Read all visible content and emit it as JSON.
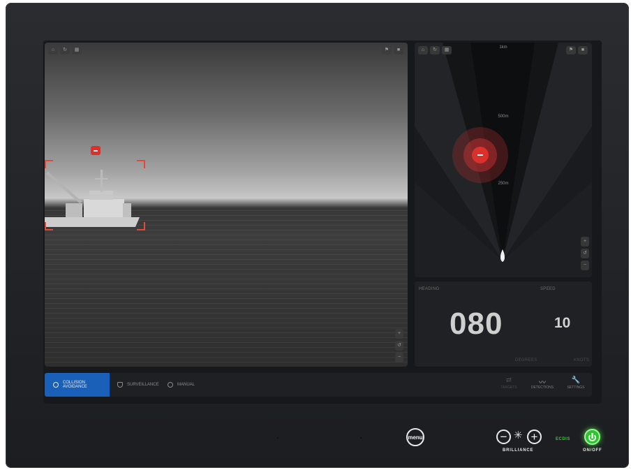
{
  "camera": {
    "toolbar_icons": [
      "home-icon",
      "rotate-icon",
      "grid-icon"
    ],
    "right_icons": [
      "flag-icon",
      "record-icon"
    ],
    "zoom_controls": [
      "+",
      "↺",
      "−"
    ]
  },
  "radar": {
    "toolbar_icons": [
      "home-icon",
      "rotate-icon",
      "grid-icon"
    ],
    "right_icons": [
      "flag-icon",
      "record-icon"
    ],
    "range_labels": [
      "1km",
      "500m",
      "250m"
    ],
    "zoom_controls": [
      "+",
      "↺",
      "−"
    ]
  },
  "nav": {
    "heading_label": "HEADING",
    "heading_value": "080",
    "heading_unit": "DEGREES",
    "speed_label": "SPEED",
    "speed_value": "10",
    "speed_unit": "KNOTS"
  },
  "modes": [
    {
      "label": "COLLISION AVOIDANCE",
      "active": true,
      "icon": "compass-icon"
    },
    {
      "label": "SURVEILLANCE",
      "active": false,
      "icon": "shield-icon"
    },
    {
      "label": "MANUAL",
      "active": false,
      "icon": "target-icon"
    }
  ],
  "tools": [
    {
      "label": "TARGETS",
      "icon": "target-switch-icon",
      "enabled": false
    },
    {
      "label": "DETECTIONS",
      "icon": "detections-icon",
      "enabled": true
    },
    {
      "label": "SETTINGS",
      "icon": "wrench-icon",
      "enabled": true
    }
  ],
  "hardware": {
    "menu_label": "menu",
    "brilliance_label": "BRILLIANCE",
    "ecdis_label": "ECDIS",
    "power_label": "ON/OFF"
  },
  "colors": {
    "accent_blue": "#1a5fb8",
    "alert_red": "#d9312b",
    "power_green": "#2fc232"
  }
}
